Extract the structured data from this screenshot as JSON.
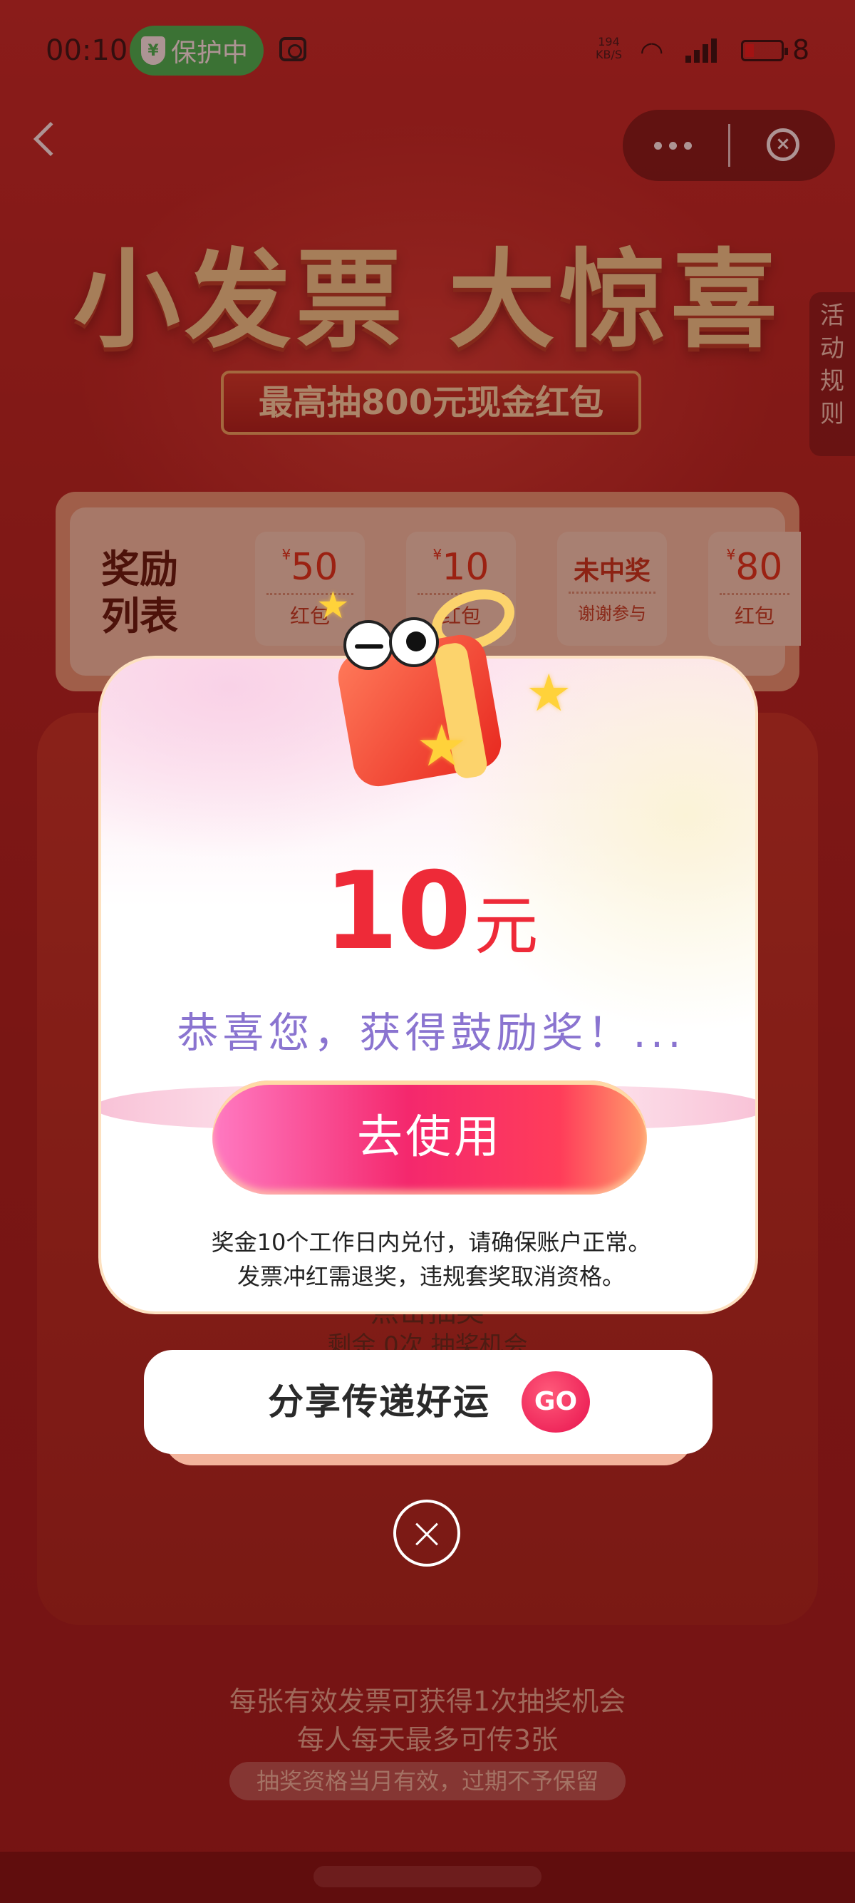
{
  "status_bar": {
    "time": "00:10",
    "protect_label": "保护中",
    "shield_glyph": "¥",
    "net_speed_value": "194",
    "net_speed_unit": "KB/S",
    "battery_level": "8",
    "battery_color": "#e22222",
    "protect_color": "#3cc45a"
  },
  "nav": {
    "back_icon": "chevron-left-icon",
    "more_icon": "more-dots-icon",
    "close_icon": "close-circle-icon",
    "close_glyph": "×"
  },
  "hero": {
    "title": "小发票 大惊喜",
    "subtitle": "最高抽800元现金红包",
    "rules_tab": "活动规则"
  },
  "rewards": {
    "title": "奖励列表",
    "currency": "¥",
    "items": [
      {
        "amount": "50",
        "label": "红包"
      },
      {
        "amount": "10",
        "label": "红包"
      },
      {
        "label": "未中奖",
        "sublabel": "谢谢参与"
      },
      {
        "amount": "80",
        "label": "红包"
      }
    ]
  },
  "draw": {
    "title": "点击抽奖",
    "remaining": "剩余 0次 抽奖机会"
  },
  "footer": {
    "line1": "每张有效发票可获得1次抽奖机会",
    "line2": "每人每天最多可传3张",
    "pill": "抽奖资格当月有效，过期不予保留"
  },
  "modal": {
    "amount": "10",
    "unit": "元",
    "message": "恭喜您，获得鼓励奖！...",
    "use_button": "去使用",
    "note_line1": "奖金10个工作日内兑付，请确保账户正常。",
    "note_line2": "发票冲红需退奖，违规套奖取消资格。",
    "amount_color": "#ee2a38",
    "message_color": "#8a74d0"
  },
  "share": {
    "label": "分享传递好运",
    "go_button": "GO"
  },
  "icons": {
    "mascot": "gift-box-mascot-icon",
    "star": "sparkle-star-icon",
    "modal_close": "close-circle-icon",
    "star_glyph": "★",
    "wifi_glyph": "◜◝"
  }
}
